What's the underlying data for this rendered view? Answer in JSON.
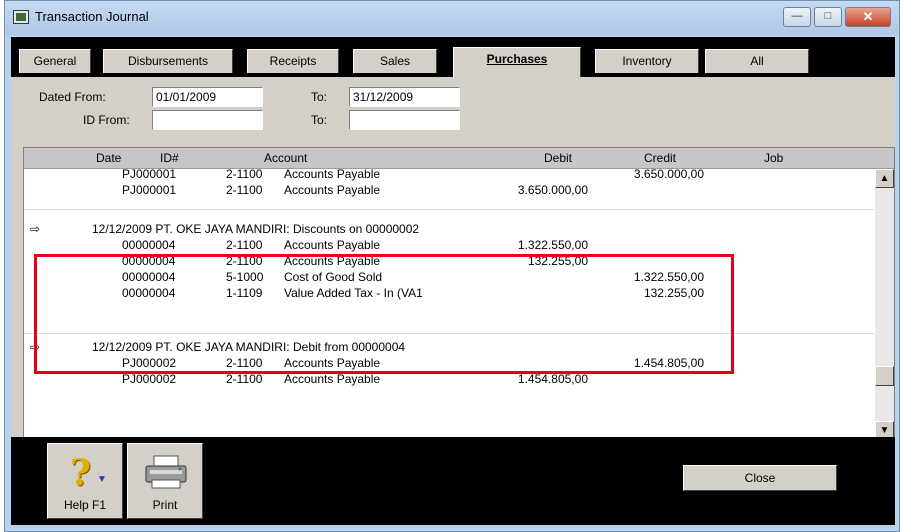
{
  "window": {
    "title": "Transaction Journal",
    "minimize_label": "—",
    "maximize_label": "□",
    "close_label": "✕"
  },
  "tabs": [
    {
      "label": "General",
      "active": false
    },
    {
      "label": "Disbursements",
      "active": false
    },
    {
      "label": "Receipts",
      "active": false
    },
    {
      "label": "Sales",
      "active": false
    },
    {
      "label": "Purchases",
      "active": true
    },
    {
      "label": "Inventory",
      "active": false
    },
    {
      "label": "All",
      "active": false
    }
  ],
  "filters": {
    "dated_from_label": "Dated From:",
    "dated_from_value": "01/01/2009",
    "to_label": "To:",
    "to_value": "31/12/2009",
    "id_from_label": "ID From:",
    "id_from_value": "",
    "id_to_label": "To:",
    "id_to_value": ""
  },
  "grid": {
    "columns": {
      "date": "Date",
      "id": "ID#",
      "account": "Account",
      "debit": "Debit",
      "credit": "Credit",
      "job": "Job"
    },
    "transactions": [
      {
        "header": "",
        "lines": [
          {
            "id": "PJ000001",
            "acc": "2-1100",
            "name": "Accounts Payable",
            "debit": "",
            "credit": "3.650.000,00"
          },
          {
            "id": "PJ000001",
            "acc": "2-1100",
            "name": "Accounts Payable",
            "debit": "3.650.000,00",
            "credit": ""
          }
        ]
      },
      {
        "header": "12/12/2009  PT. OKE JAYA MANDIRI:  Discounts on 00000002",
        "lines": [
          {
            "id": "00000004",
            "acc": "2-1100",
            "name": "Accounts Payable",
            "debit": "1.322.550,00",
            "credit": ""
          },
          {
            "id": "00000004",
            "acc": "2-1100",
            "name": "Accounts Payable",
            "debit": "132.255,00",
            "credit": ""
          },
          {
            "id": "00000004",
            "acc": "5-1000",
            "name": "Cost of Good Sold",
            "debit": "",
            "credit": "1.322.550,00"
          },
          {
            "id": "00000004",
            "acc": "1-1109",
            "name": "Value Added Tax - In (VA1",
            "debit": "",
            "credit": "132.255,00"
          }
        ]
      },
      {
        "header": "12/12/2009  PT. OKE JAYA MANDIRI:  Debit from 00000004",
        "lines": [
          {
            "id": "PJ000002",
            "acc": "2-1100",
            "name": "Accounts Payable",
            "debit": "",
            "credit": "1.454.805,00"
          },
          {
            "id": "PJ000002",
            "acc": "2-1100",
            "name": "Accounts Payable",
            "debit": "1.454.805,00",
            "credit": ""
          }
        ]
      }
    ]
  },
  "toolbar": {
    "help_label": "Help F1",
    "print_label": "Print",
    "close_label": "Close"
  },
  "colors": {
    "highlight": "#e2001a",
    "title_bar": "#b9d1ea",
    "panel": "#d4d0c8"
  }
}
